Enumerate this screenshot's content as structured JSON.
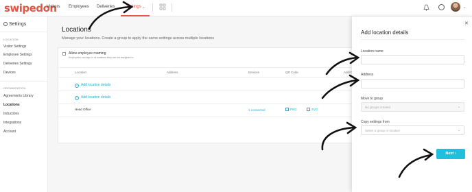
{
  "brand": {
    "name": "swipedon",
    "accent": "#e8543f",
    "link_color": "#2ba6c8",
    "button_color": "#1fbfdd"
  },
  "topnav": {
    "items": [
      "Visitors",
      "Employees",
      "Deliveries",
      "Settings"
    ],
    "active": "Settings",
    "icons": [
      "grid-icon",
      "bell-icon",
      "help-icon",
      "avatar"
    ]
  },
  "sidebar": {
    "title": "Settings",
    "sections": [
      {
        "heading": "LOCATION",
        "items": [
          "Visitor Settings",
          "Employee Settings",
          "Deliveries Settings",
          "Devices"
        ]
      },
      {
        "heading": "ORGANIZATION",
        "items": [
          "Agreements Library",
          "Locations",
          "Inductions",
          "Integrations",
          "Account"
        ]
      }
    ],
    "active_item": "Locations"
  },
  "main": {
    "title": "Locations",
    "subtitle": "Manage your locations. Create a group to apply the same settings across multiple locations",
    "roaming_label": "Allow employee roaming",
    "roaming_help": "Employees can sign in at locations they are not assigned to",
    "columns": [
      "Location",
      "Address",
      "Devices",
      "QR Code",
      "Add/Ch"
    ],
    "add_rows": [
      "Add location details",
      "Add location details"
    ],
    "office": {
      "name": "Head Office",
      "devices": "1 connected",
      "qr_png": "PNG",
      "qr_svg": "SVG"
    }
  },
  "panel": {
    "title": "Add location details",
    "fields": {
      "name_label": "Location name",
      "address_label": "Address",
      "group_label": "Move to group",
      "group_placeholder": "No groups created",
      "copy_label": "Copy settings from",
      "copy_placeholder": "Select a group or location"
    },
    "next_label": "Next"
  }
}
